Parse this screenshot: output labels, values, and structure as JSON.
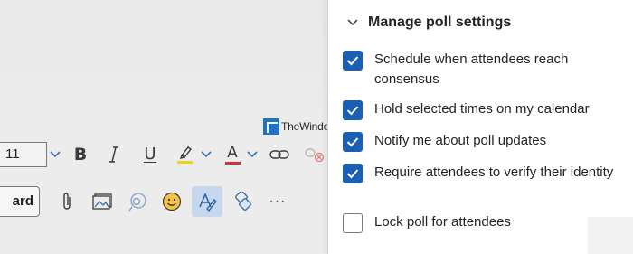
{
  "toolbar": {
    "font_size_value": "11",
    "underline_glyph": "U",
    "font_color_glyph": "A",
    "highlight_color": "#f3d31a",
    "font_color": "#d13438",
    "more_glyph": "···"
  },
  "insert_bar": {
    "card_button_label": "ard"
  },
  "watermark": {
    "text": "TheWindowsClub.com"
  },
  "poll_settings": {
    "title": "Manage poll settings",
    "options": [
      {
        "label": "Schedule when attendees reach consensus",
        "checked": true
      },
      {
        "label": "Hold selected times on my calendar",
        "checked": true
      },
      {
        "label": "Notify me about poll updates",
        "checked": true
      },
      {
        "label": "Require attendees to verify their identity",
        "checked": true
      },
      {
        "label": "Lock poll for attendees",
        "checked": false
      }
    ]
  },
  "colors": {
    "accent": "#1a5fb4",
    "panel_bg": "#ffffff",
    "page_bg": "#ececec"
  }
}
